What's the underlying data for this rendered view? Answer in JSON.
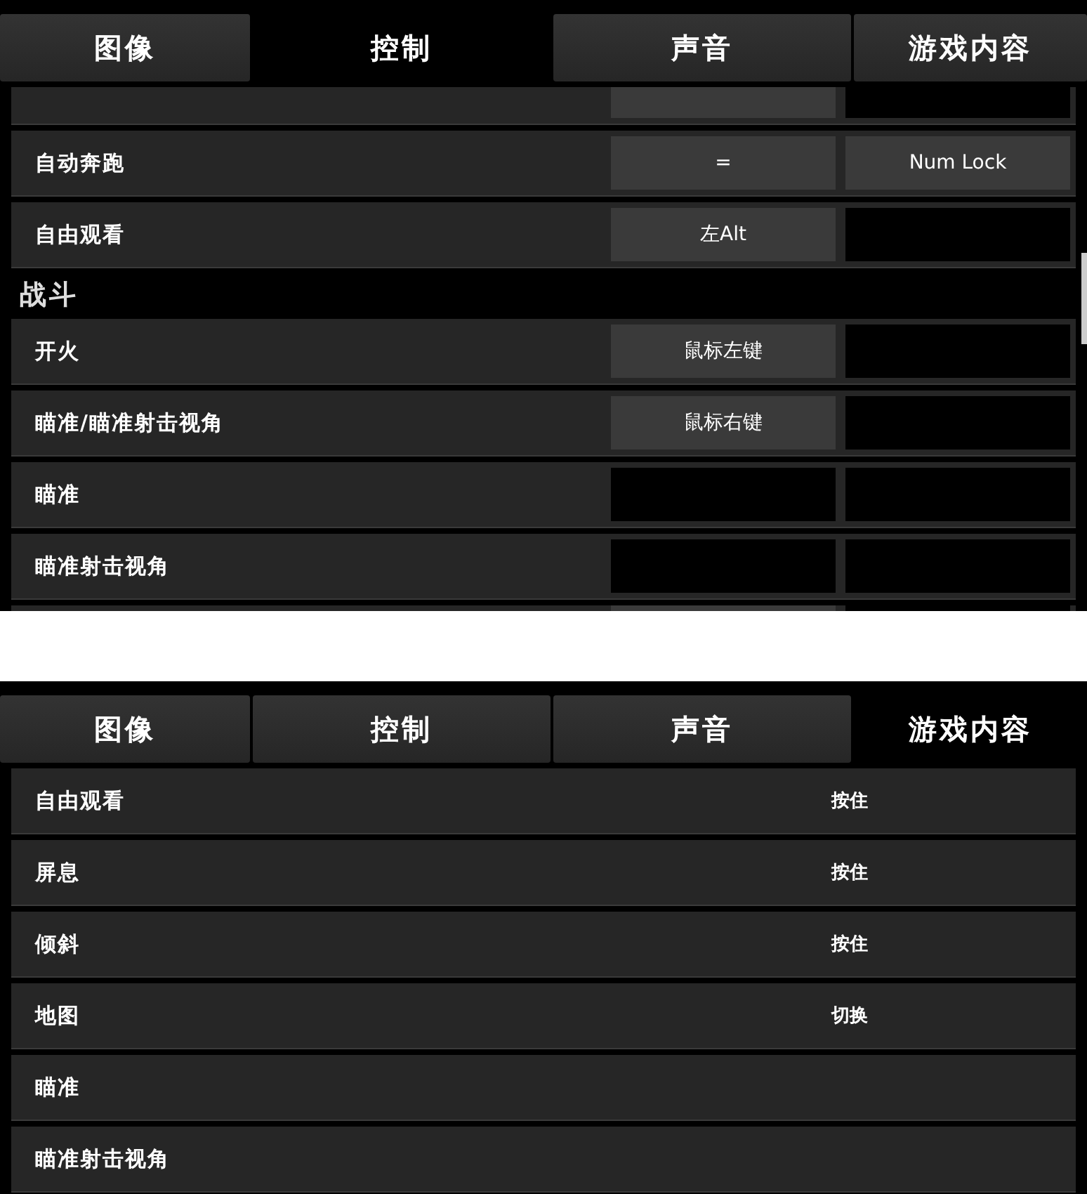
{
  "panels": [
    {
      "tabs": [
        {
          "label": "图像",
          "selected": false
        },
        {
          "label": "控制",
          "selected": true
        },
        {
          "label": "声音",
          "selected": false
        },
        {
          "label": "游戏内容",
          "selected": false
        }
      ],
      "items": [
        {
          "kind": "cut",
          "keys": [
            {
              "bound": true
            },
            {
              "bound": false
            }
          ]
        },
        {
          "kind": "binding",
          "label": "自动奔跑",
          "keys": [
            {
              "bound": true,
              "text": "="
            },
            {
              "bound": true,
              "text": "Num Lock"
            }
          ]
        },
        {
          "kind": "binding",
          "label": "自由观看",
          "keys": [
            {
              "bound": true,
              "text": "左Alt"
            },
            {
              "bound": false
            }
          ]
        },
        {
          "kind": "section",
          "label": "战斗"
        },
        {
          "kind": "binding",
          "label": "开火",
          "keys": [
            {
              "bound": true,
              "text": "鼠标左键"
            },
            {
              "bound": false
            }
          ]
        },
        {
          "kind": "binding",
          "label": "瞄准/瞄准射击视角",
          "keys": [
            {
              "bound": true,
              "text": "鼠标右键"
            },
            {
              "bound": false
            }
          ]
        },
        {
          "kind": "binding",
          "label": "瞄准",
          "keys": [
            {
              "bound": false
            },
            {
              "bound": false
            }
          ]
        },
        {
          "kind": "binding",
          "label": "瞄准射击视角",
          "keys": [
            {
              "bound": false
            },
            {
              "bound": false
            }
          ]
        },
        {
          "kind": "cut",
          "keys": [
            {
              "bound": true
            },
            {
              "bound": false
            }
          ]
        }
      ]
    },
    {
      "tabs": [
        {
          "label": "图像",
          "selected": false
        },
        {
          "label": "控制",
          "selected": false
        },
        {
          "label": "声音",
          "selected": false
        },
        {
          "label": "游戏内容",
          "selected": true
        }
      ],
      "items": [
        {
          "kind": "option",
          "label": "自由观看",
          "value": "按住"
        },
        {
          "kind": "option",
          "label": "屏息",
          "value": "按住"
        },
        {
          "kind": "option",
          "label": "倾斜",
          "value": "按住"
        },
        {
          "kind": "option",
          "label": "地图",
          "value": "切换"
        },
        {
          "kind": "option",
          "label": "瞄准"
        },
        {
          "kind": "option",
          "label": "瞄准射击视角"
        }
      ]
    }
  ]
}
